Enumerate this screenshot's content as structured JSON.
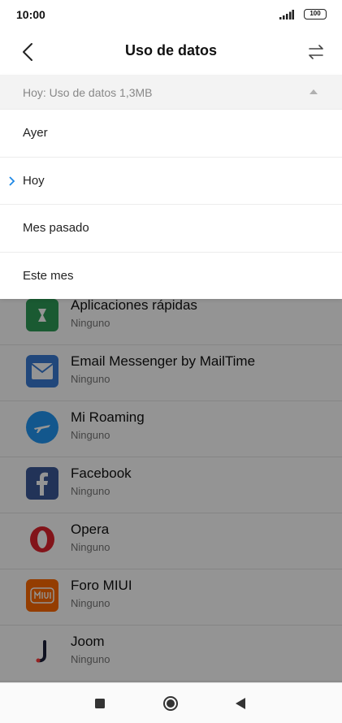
{
  "status": {
    "time": "10:00",
    "battery": "100"
  },
  "header": {
    "title": "Uso de datos"
  },
  "filter": {
    "current": "Hoy: Uso de datos 1,3MB",
    "options": [
      {
        "label": "Ayer",
        "selected": false
      },
      {
        "label": "Hoy",
        "selected": true
      },
      {
        "label": "Mes pasado",
        "selected": false
      },
      {
        "label": "Este mes",
        "selected": false
      }
    ]
  },
  "apps": [
    {
      "name": "Aplicaciones rápidas",
      "status": "Ninguno",
      "icon": "quick-apps-icon"
    },
    {
      "name": "Email Messenger by MailTime",
      "status": "Ninguno",
      "icon": "mail-icon"
    },
    {
      "name": "Mi Roaming",
      "status": "Ninguno",
      "icon": "airplane-icon"
    },
    {
      "name": "Facebook",
      "status": "Ninguno",
      "icon": "facebook-icon"
    },
    {
      "name": "Opera",
      "status": "Ninguno",
      "icon": "opera-icon"
    },
    {
      "name": "Foro MIUI",
      "status": "Ninguno",
      "icon": "miui-forum-icon"
    },
    {
      "name": "Joom",
      "status": "Ninguno",
      "icon": "joom-icon"
    }
  ],
  "colors": {
    "accent": "#1e88e5",
    "overlay": "#6b6b6b"
  }
}
